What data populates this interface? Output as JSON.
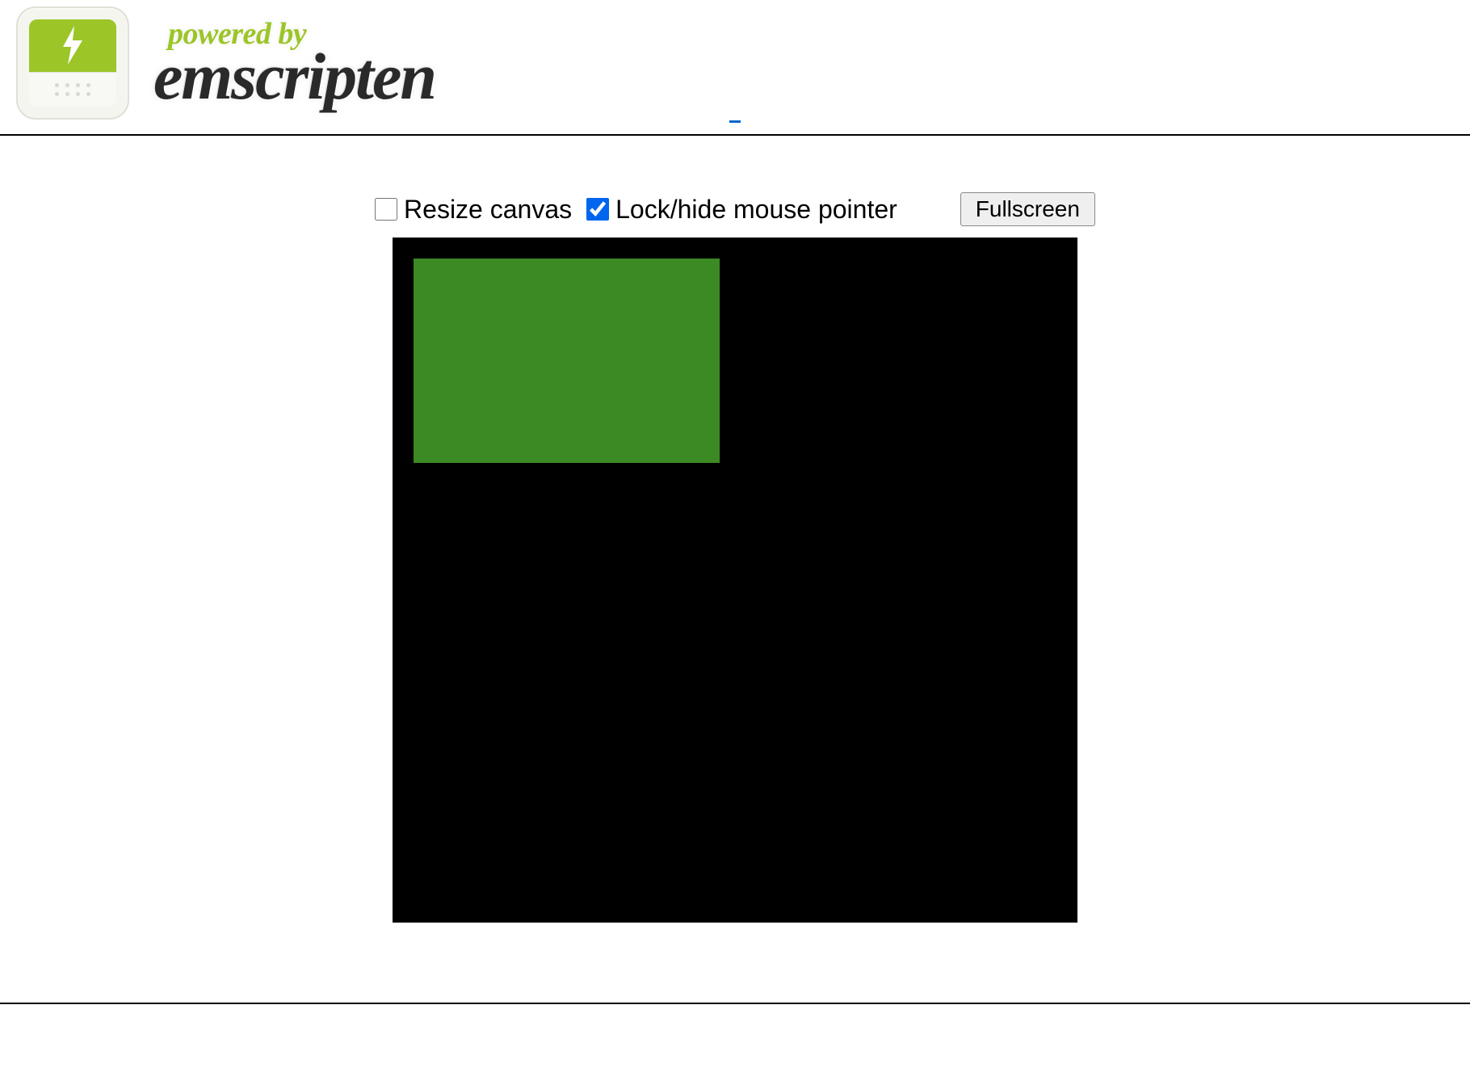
{
  "header": {
    "powered_by": "powered by",
    "title": "emscripten"
  },
  "controls": {
    "resize_canvas_label": "Resize canvas",
    "resize_canvas_checked": false,
    "lock_pointer_label": "Lock/hide mouse pointer",
    "lock_pointer_checked": true,
    "fullscreen_label": "Fullscreen"
  },
  "canvas": {
    "bg_color": "#000000",
    "rect_color": "#3b8a23"
  }
}
